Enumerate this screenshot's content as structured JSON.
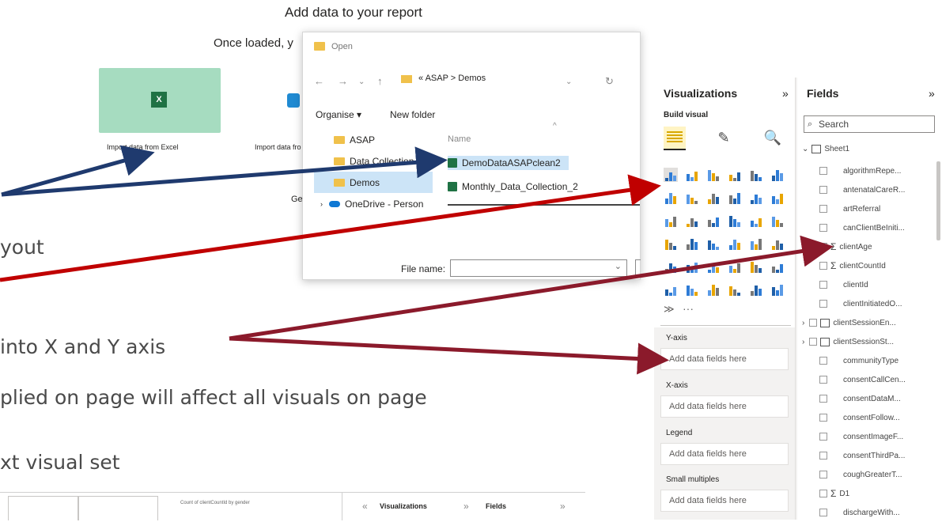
{
  "slide": {
    "bullets": [
      "yout",
      " into X and Y axis",
      "plied on page will affect all visuals on page",
      "xt visual set"
    ]
  },
  "add_data": {
    "title": "Add data to your report",
    "subtitle": "Once loaded, y",
    "sources": [
      {
        "label": "Import data from Excel",
        "color": "#a6dcc0"
      },
      {
        "label": "Import data fro",
        "color": "#ffffff"
      }
    ],
    "partial_text": "Ge"
  },
  "open_dialog": {
    "title": "Open",
    "path": [
      "«",
      "ASAP",
      ">",
      "Demos"
    ],
    "toolbar": {
      "organise": "Organise ▾",
      "new_folder": "New folder"
    },
    "tree": [
      {
        "label": "ASAP",
        "type": "folder",
        "selected": false
      },
      {
        "label": "Data Collection",
        "type": "folder",
        "selected": false
      },
      {
        "label": "Demos",
        "type": "folder",
        "selected": true
      },
      {
        "label": "OneDrive - Person",
        "type": "cloud",
        "selected": false
      }
    ],
    "column_header": "Name",
    "files": [
      {
        "label": "DemoDataASAPclean2",
        "selected": true
      },
      {
        "label": "Monthly_Data_Collection_2",
        "selected": false
      }
    ],
    "file_name_label": "File name:"
  },
  "visualizations": {
    "title": "Visualizations",
    "collapse": "»",
    "build_visual": "Build visual",
    "more": "···",
    "wells": [
      {
        "title": "Y-axis",
        "placeholder": "Add data fields here"
      },
      {
        "title": "X-axis",
        "placeholder": "Add data fields here"
      },
      {
        "title": "Legend",
        "placeholder": "Add data fields here"
      },
      {
        "title": "Small multiples",
        "placeholder": "Add data fields here"
      }
    ]
  },
  "fields": {
    "title": "Fields",
    "collapse": "»",
    "search_placeholder": "Search",
    "table": "Sheet1",
    "items": [
      {
        "label": "algorithmRepe...",
        "sigma": false,
        "expand": false
      },
      {
        "label": "antenatalCareR...",
        "sigma": false,
        "expand": false
      },
      {
        "label": "artReferral",
        "sigma": false,
        "expand": false
      },
      {
        "label": "canClientBeIniti...",
        "sigma": false,
        "expand": false
      },
      {
        "label": "clientAge",
        "sigma": true,
        "expand": false
      },
      {
        "label": "clientCountId",
        "sigma": true,
        "expand": false
      },
      {
        "label": "clientId",
        "sigma": false,
        "expand": false
      },
      {
        "label": "clientInitiatedO...",
        "sigma": false,
        "expand": false
      },
      {
        "label": "clientSessionEn...",
        "sigma": false,
        "expand": true
      },
      {
        "label": "clientSessionSt...",
        "sigma": false,
        "expand": true
      },
      {
        "label": "communityType",
        "sigma": false,
        "expand": false
      },
      {
        "label": "consentCallCen...",
        "sigma": false,
        "expand": false
      },
      {
        "label": "consentDataM...",
        "sigma": false,
        "expand": false
      },
      {
        "label": "consentFollow...",
        "sigma": false,
        "expand": false
      },
      {
        "label": "consentImageF...",
        "sigma": false,
        "expand": false
      },
      {
        "label": "consentThirdPa...",
        "sigma": false,
        "expand": false
      },
      {
        "label": "coughGreaterT...",
        "sigma": false,
        "expand": false
      },
      {
        "label": "D1",
        "sigma": true,
        "expand": false
      },
      {
        "label": "dischargeWith...",
        "sigma": false,
        "expand": false
      }
    ]
  },
  "thumbnail": {
    "chart_title": "Count of clientCountId by gender",
    "viz_title": "Visualizations",
    "fields_title": "Fields",
    "collapse_left": "«",
    "collapse_mid": "»",
    "collapse_right": "»"
  },
  "colors": {
    "arrow_blue": "#1f3a6e",
    "arrow_red": "#c00000",
    "arrow_maroon": "#8b1a2b",
    "excel_green": "#a6dcc0"
  }
}
